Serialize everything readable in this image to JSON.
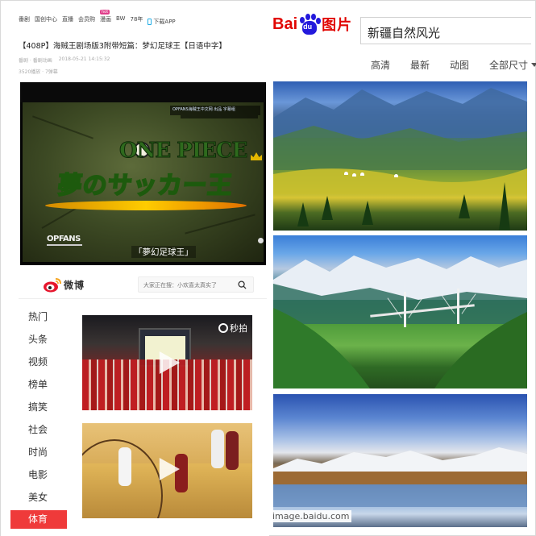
{
  "video_site": {
    "nav": [
      "番剧",
      "国创中心",
      "直播",
      "会员购",
      "漫画",
      "BW",
      "78年",
      "下载APP"
    ],
    "nav_hot_badge": "hot",
    "title": "【408P】海贼王剧场版3附带短篇：梦幻足球王【日语中字】",
    "meta_category": "番剧 · 番剧动画",
    "meta_date": "2018-05-21 14:15:32",
    "stats": "3520播放 · 7弹幕",
    "player": {
      "caption": "OPFANS海贼王中文网 出品 字幕组",
      "logo_text": "ONE PIECE",
      "movie_title": "夢のサッカー王",
      "fansub": "OPFANS",
      "subtitle": "「夢幻足球王」"
    }
  },
  "weibo": {
    "brand": "微博",
    "search_placeholder": "大家正在搜：小欢喜太真实了",
    "nav_items": [
      "热门",
      "头条",
      "视频",
      "榜单",
      "搞笑",
      "社会",
      "时尚",
      "电影",
      "美女",
      "体育"
    ],
    "active_index": 9,
    "video_source": "秒拍"
  },
  "baidu": {
    "logo_left": "Bai",
    "logo_paw_text": "du",
    "logo_right": "图片",
    "query": "新疆自然风光",
    "filters": [
      "高清",
      "最新",
      "动图",
      "全部尺寸"
    ],
    "watermark": "image.baidu.com",
    "colors": {
      "brand_red": "#e10602",
      "brand_blue": "#2319dc",
      "weibo_active": "#ef3a3a"
    }
  }
}
